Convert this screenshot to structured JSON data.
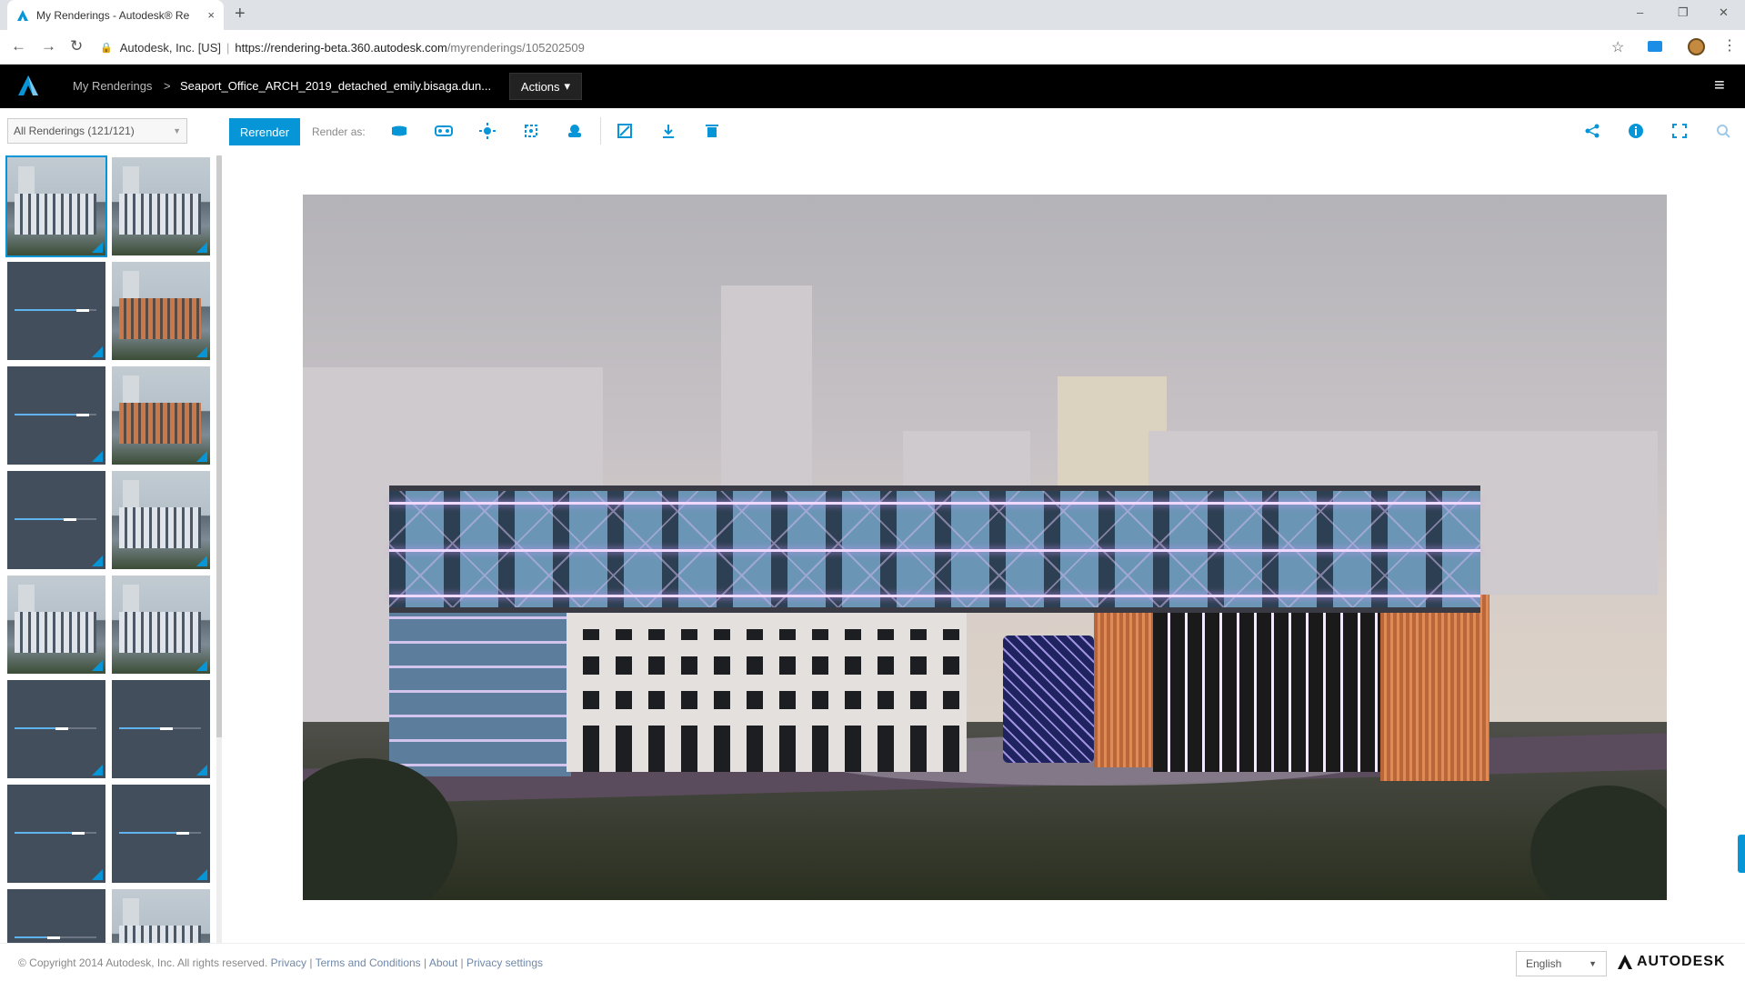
{
  "browser": {
    "tab_title": "My Renderings - Autodesk® Re",
    "tab_close": "×",
    "new_tab": "+",
    "minimize": "–",
    "restore": "❐",
    "close": "✕",
    "url_org": "Autodesk, Inc. [US]",
    "url_host": "https://rendering-beta.360.autodesk.com",
    "url_path": "/myrenderings/105202509",
    "back": "←",
    "forward": "→",
    "reload": "↻",
    "star": "☆",
    "more": "⋮"
  },
  "app": {
    "crumb_root": "My Renderings",
    "crumb_arrow": ">",
    "crumb_file": "Seaport_Office_ARCH_2019_detached_emily.bisaga.dun...",
    "actions_label": "Actions",
    "hamburger": "≡",
    "accent": "#0696d7"
  },
  "toolbar": {
    "filter_value": "All Renderings  (121/121)",
    "rerender_label": "Rerender",
    "render_as_label": "Render as:",
    "icons": [
      "panorama-icon",
      "stereo-icon",
      "illuminance-icon",
      "region-icon",
      "cloud-icon",
      "adjust-exposure-icon",
      "download-icon",
      "delete-icon"
    ],
    "right_icons": [
      "share-icon",
      "info-icon",
      "fullscreen-icon",
      "zoom-icon"
    ]
  },
  "thumbnails": [
    {
      "kind": "render",
      "selected": true
    },
    {
      "kind": "render",
      "selected": false
    },
    {
      "kind": "pending",
      "progress": 0.75
    },
    {
      "kind": "render-warm",
      "selected": false
    },
    {
      "kind": "pending",
      "progress": 0.75
    },
    {
      "kind": "render-warm",
      "selected": false
    },
    {
      "kind": "pending",
      "progress": 0.6
    },
    {
      "kind": "render",
      "selected": false
    },
    {
      "kind": "render",
      "selected": false
    },
    {
      "kind": "render",
      "selected": false
    },
    {
      "kind": "pending",
      "progress": 0.5
    },
    {
      "kind": "pending",
      "progress": 0.5
    },
    {
      "kind": "pending",
      "progress": 0.7
    },
    {
      "kind": "pending",
      "progress": 0.7
    },
    {
      "kind": "pending",
      "progress": 0.4
    },
    {
      "kind": "render",
      "selected": false
    }
  ],
  "viewer": {
    "next_label": "›"
  },
  "footer": {
    "copyright": "© Copyright 2014 Autodesk, Inc. All rights reserved.",
    "privacy": "Privacy",
    "terms": "Terms and Conditions",
    "about": "About",
    "privacy_settings": "Privacy settings",
    "sep": "|",
    "language": "English",
    "brand": "AUTODESK"
  }
}
